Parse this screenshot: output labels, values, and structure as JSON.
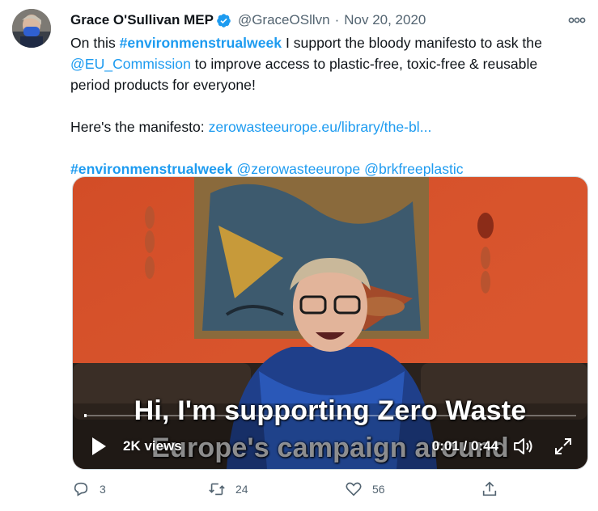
{
  "tweet": {
    "author_name": "Grace O'Sullivan MEP",
    "handle": "@GraceOSllvn",
    "separator": "·",
    "date": "Nov 20, 2020",
    "line1_pre": "On this ",
    "line1_tag": "#environmenstrualweek",
    "line1_post": " I support the bloody manifesto to ask the",
    "line2_mention": "@EU_Commission",
    "line2_post": " to improve access to plastic-free, toxic-free & reusable",
    "line3": "period products for everyone!",
    "manifesto_pre": "Here's the manifesto: ",
    "manifesto_link": "zerowasteeurope.eu/library/the-bl...",
    "footer_tag": "#environmenstrualweek",
    "footer_mention1": "@zerowasteeurope",
    "footer_mention2": "@brkfreeplastic"
  },
  "video": {
    "caption_line1": "Hi, I'm supporting Zero Waste",
    "caption_line2": "Europe's campaign around",
    "views": "2K views",
    "time": "0:01 / 0:44",
    "progress": 0.005
  },
  "actions": {
    "replies": "3",
    "retweets": "24",
    "likes": "56"
  },
  "colors": {
    "accent": "#1d9bf0",
    "muted": "#536471",
    "wall": "#d9532c"
  },
  "icons": [
    "verified-badge-icon",
    "more-icon",
    "play-icon",
    "volume-icon",
    "fullscreen-icon",
    "reply-icon",
    "retweet-icon",
    "like-icon",
    "share-icon"
  ]
}
